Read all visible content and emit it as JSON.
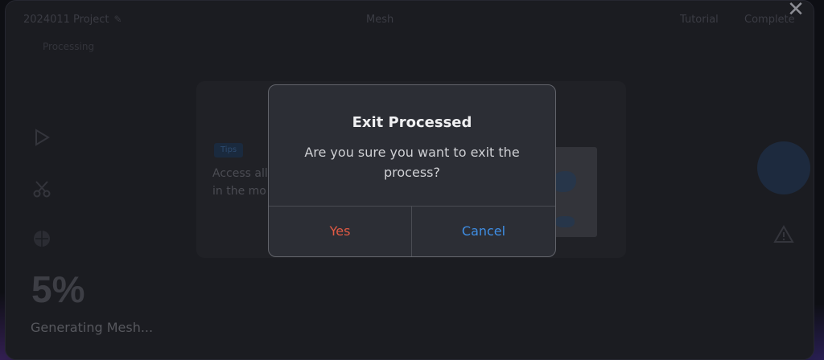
{
  "header": {
    "project_name": "2024011 Project",
    "center_tab": "Mesh",
    "right_link_1": "Tutorial",
    "right_link_2": "Complete",
    "sub_label": "Processing"
  },
  "tip": {
    "badge": "Tips",
    "text_line1": "Access all",
    "text_line2": "in the mo"
  },
  "progress": {
    "value": "5%",
    "label": "Generating Mesh..."
  },
  "dialog": {
    "title": "Exit Processed",
    "message": "Are you sure you want to exit the process?",
    "confirm_label": "Yes",
    "cancel_label": "Cancel"
  },
  "colors": {
    "confirm": "#e05a44",
    "cancel": "#3f8ee4",
    "accent_fab": "#1d2a3e"
  },
  "icons": {
    "close": "close-icon",
    "play": "play-icon",
    "scissors": "scissors-icon",
    "globe": "globe-icon",
    "warning": "warning-icon",
    "edit": "edit-icon"
  }
}
